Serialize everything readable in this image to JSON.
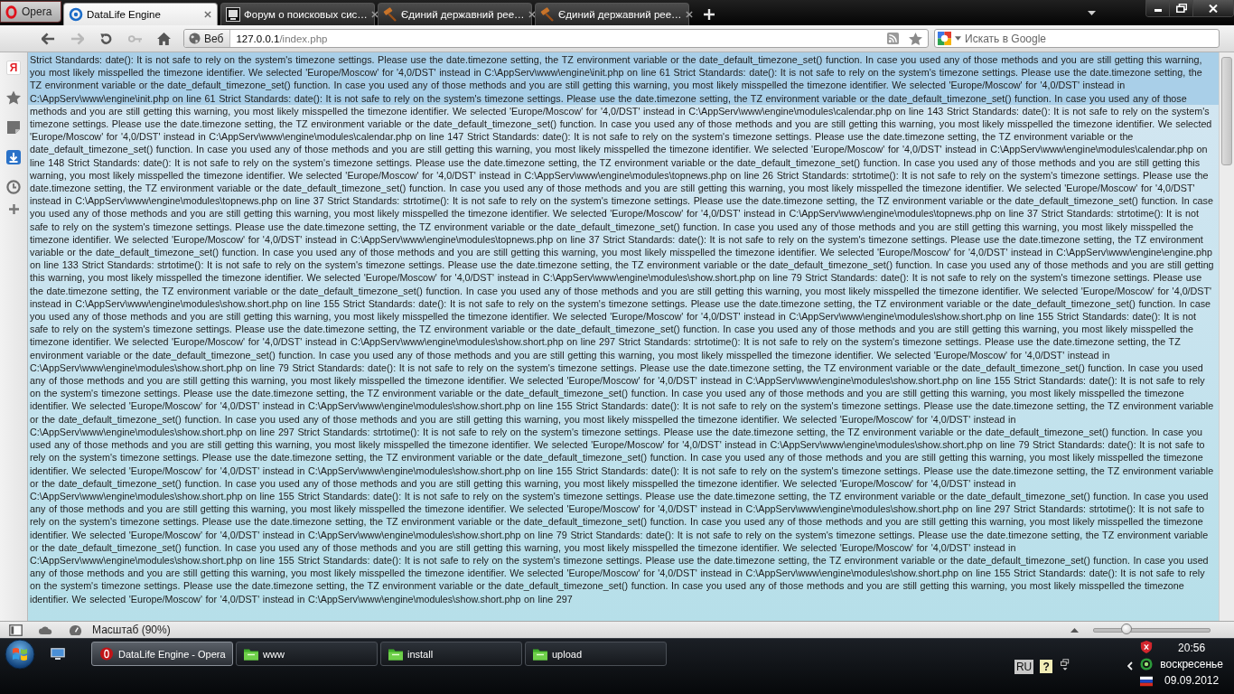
{
  "browser": {
    "menu_button": "Opera",
    "tabs": [
      {
        "title": "DataLife Engine",
        "kind": "portal",
        "selected": true
      },
      {
        "title": "Форум о поисковых сис…",
        "kind": "forum",
        "selected": false
      },
      {
        "title": "Єдиний державний рее…",
        "kind": "registry",
        "selected": false
      },
      {
        "title": "Єдиний державний рее…",
        "kind": "registry",
        "selected": false
      }
    ],
    "nav_buttons": [
      {
        "kind": "back",
        "disabled": false
      },
      {
        "kind": "forward",
        "disabled": true
      },
      {
        "kind": "reload",
        "disabled": false
      },
      {
        "kind": "wand",
        "disabled": true
      },
      {
        "kind": "home",
        "disabled": false
      }
    ],
    "address_bar": {
      "badge": "Веб",
      "host": "127.0.0.1",
      "path": "/index.php"
    },
    "search": {
      "placeholder": "Искать в Google"
    },
    "side_panel": {
      "letter_button": "Я"
    },
    "page": {
      "messages": [
        "Strict Standards: date(): It is not safe to rely on the system's timezone settings. Please use the date.timezone setting, the TZ environment variable or the date_default_timezone_set() function. In case you used any of those methods and you are still getting this warning, you most likely misspelled the timezone identifier. We selected 'Europe/Moscow' for '4,0/DST' instead in C:\\AppServ\\www\\engine\\init.php on line 61",
        "Strict Standards: date(): It is not safe to rely on the system's timezone settings. Please use the date.timezone setting, the TZ environment variable or the date_default_timezone_set() function. In case you used any of those methods and you are still getting this warning, you most likely misspelled the timezone identifier. We selected 'Europe/Moscow' for '4,0/DST' instead in C:\\AppServ\\www\\engine\\init.php on line 61",
        "Strict Standards: date(): It is not safe to rely on the system's timezone settings. Please use the date.timezone setting, the TZ environment variable or the date_default_timezone_set() function. In case you used any of those methods and you are still getting this warning, you most likely misspelled the timezone identifier. We selected 'Europe/Moscow' for '4,0/DST' instead in C:\\AppServ\\www\\engine\\modules\\calendar.php on line 143",
        "Strict Standards: date(): It is not safe to rely on the system's timezone settings. Please use the date.timezone setting, the TZ environment variable or the date_default_timezone_set() function. In case you used any of those methods and you are still getting this warning, you most likely misspelled the timezone identifier. We selected 'Europe/Moscow' for '4,0/DST' instead in C:\\AppServ\\www\\engine\\modules\\calendar.php on line 147",
        "Strict Standards: date(): It is not safe to rely on the system's timezone settings. Please use the date.timezone setting, the TZ environment variable or the date_default_timezone_set() function. In case you used any of those methods and you are still getting this warning, you most likely misspelled the timezone identifier. We selected 'Europe/Moscow' for '4,0/DST' instead in C:\\AppServ\\www\\engine\\modules\\calendar.php on line 148",
        "Strict Standards: date(): It is not safe to rely on the system's timezone settings. Please use the date.timezone setting, the TZ environment variable or the date_default_timezone_set() function. In case you used any of those methods and you are still getting this warning, you most likely misspelled the timezone identifier. We selected 'Europe/Moscow' for '4,0/DST' instead in C:\\AppServ\\www\\engine\\modules\\topnews.php on line 26",
        "Strict Standards: strtotime(): It is not safe to rely on the system's timezone settings. Please use the date.timezone setting, the TZ environment variable or the date_default_timezone_set() function. In case you used any of those methods and you are still getting this warning, you most likely misspelled the timezone identifier. We selected 'Europe/Moscow' for '4,0/DST' instead in C:\\AppServ\\www\\engine\\modules\\topnews.php on line 37",
        "Strict Standards: strtotime(): It is not safe to rely on the system's timezone settings. Please use the date.timezone setting, the TZ environment variable or the date_default_timezone_set() function. In case you used any of those methods and you are still getting this warning, you most likely misspelled the timezone identifier. We selected 'Europe/Moscow' for '4,0/DST' instead in C:\\AppServ\\www\\engine\\modules\\topnews.php on line 37",
        "Strict Standards: strtotime(): It is not safe to rely on the system's timezone settings. Please use the date.timezone setting, the TZ environment variable or the date_default_timezone_set() function. In case you used any of those methods and you are still getting this warning, you most likely misspelled the timezone identifier. We selected 'Europe/Moscow' for '4,0/DST' instead in C:\\AppServ\\www\\engine\\modules\\topnews.php on line 37",
        "Strict Standards: date(): It is not safe to rely on the system's timezone settings. Please use the date.timezone setting, the TZ environment variable or the date_default_timezone_set() function. In case you used any of those methods and you are still getting this warning, you most likely misspelled the timezone identifier. We selected 'Europe/Moscow' for '4,0/DST' instead in C:\\AppServ\\www\\engine\\engine.php on line 133",
        "Strict Standards: strtotime(): It is not safe to rely on the system's timezone settings. Please use the date.timezone setting, the TZ environment variable or the date_default_timezone_set() function. In case you used any of those methods and you are still getting this warning, you most likely misspelled the timezone identifier. We selected 'Europe/Moscow' for '4,0/DST' instead in C:\\AppServ\\www\\engine\\modules\\show.short.php on line 79",
        "Strict Standards: date(): It is not safe to rely on the system's timezone settings. Please use the date.timezone setting, the TZ environment variable or the date_default_timezone_set() function. In case you used any of those methods and you are still getting this warning, you most likely misspelled the timezone identifier. We selected 'Europe/Moscow' for '4,0/DST' instead in C:\\AppServ\\www\\engine\\modules\\show.short.php on line 155",
        "Strict Standards: date(): It is not safe to rely on the system's timezone settings. Please use the date.timezone setting, the TZ environment variable or the date_default_timezone_set() function. In case you used any of those methods and you are still getting this warning, you most likely misspelled the timezone identifier. We selected 'Europe/Moscow' for '4,0/DST' instead in C:\\AppServ\\www\\engine\\modules\\show.short.php on line 155",
        "Strict Standards: date(): It is not safe to rely on the system's timezone settings. Please use the date.timezone setting, the TZ environment variable or the date_default_timezone_set() function. In case you used any of those methods and you are still getting this warning, you most likely misspelled the timezone identifier. We selected 'Europe/Moscow' for '4,0/DST' instead in C:\\AppServ\\www\\engine\\modules\\show.short.php on line 297",
        "Strict Standards: strtotime(): It is not safe to rely on the system's timezone settings. Please use the date.timezone setting, the TZ environment variable or the date_default_timezone_set() function. In case you used any of those methods and you are still getting this warning, you most likely misspelled the timezone identifier. We selected 'Europe/Moscow' for '4,0/DST' instead in C:\\AppServ\\www\\engine\\modules\\show.short.php on line 79",
        "Strict Standards: date(): It is not safe to rely on the system's timezone settings. Please use the date.timezone setting, the TZ environment variable or the date_default_timezone_set() function. In case you used any of those methods and you are still getting this warning, you most likely misspelled the timezone identifier. We selected 'Europe/Moscow' for '4,0/DST' instead in C:\\AppServ\\www\\engine\\modules\\show.short.php on line 155",
        "Strict Standards: date(): It is not safe to rely on the system's timezone settings. Please use the date.timezone setting, the TZ environment variable or the date_default_timezone_set() function. In case you used any of those methods and you are still getting this warning, you most likely misspelled the timezone identifier. We selected 'Europe/Moscow' for '4,0/DST' instead in C:\\AppServ\\www\\engine\\modules\\show.short.php on line 155",
        "Strict Standards: date(): It is not safe to rely on the system's timezone settings. Please use the date.timezone setting, the TZ environment variable or the date_default_timezone_set() function. In case you used any of those methods and you are still getting this warning, you most likely misspelled the timezone identifier. We selected 'Europe/Moscow' for '4,0/DST' instead in C:\\AppServ\\www\\engine\\modules\\show.short.php on line 297",
        "Strict Standards: strtotime(): It is not safe to rely on the system's timezone settings. Please use the date.timezone setting, the TZ environment variable or the date_default_timezone_set() function. In case you used any of those methods and you are still getting this warning, you most likely misspelled the timezone identifier. We selected 'Europe/Moscow' for '4,0/DST' instead in C:\\AppServ\\www\\engine\\modules\\show.short.php on line 79",
        "Strict Standards: date(): It is not safe to rely on the system's timezone settings. Please use the date.timezone setting, the TZ environment variable or the date_default_timezone_set() function. In case you used any of those methods and you are still getting this warning, you most likely misspelled the timezone identifier. We selected 'Europe/Moscow' for '4,0/DST' instead in C:\\AppServ\\www\\engine\\modules\\show.short.php on line 155",
        "Strict Standards: date(): It is not safe to rely on the system's timezone settings. Please use the date.timezone setting, the TZ environment variable or the date_default_timezone_set() function. In case you used any of those methods and you are still getting this warning, you most likely misspelled the timezone identifier. We selected 'Europe/Moscow' for '4,0/DST' instead in C:\\AppServ\\www\\engine\\modules\\show.short.php on line 155",
        "Strict Standards: date(): It is not safe to rely on the system's timezone settings. Please use the date.timezone setting, the TZ environment variable or the date_default_timezone_set() function. In case you used any of those methods and you are still getting this warning, you most likely misspelled the timezone identifier. We selected 'Europe/Moscow' for '4,0/DST' instead in C:\\AppServ\\www\\engine\\modules\\show.short.php on line 297",
        "Strict Standards: strtotime(): It is not safe to rely on the system's timezone settings. Please use the date.timezone setting, the TZ environment variable or the date_default_timezone_set() function. In case you used any of those methods and you are still getting this warning, you most likely misspelled the timezone identifier. We selected 'Europe/Moscow' for '4,0/DST' instead in C:\\AppServ\\www\\engine\\modules\\show.short.php on line 79",
        "Strict Standards: date(): It is not safe to rely on the system's timezone settings. Please use the date.timezone setting, the TZ environment variable or the date_default_timezone_set() function. In case you used any of those methods and you are still getting this warning, you most likely misspelled the timezone identifier. We selected 'Europe/Moscow' for '4,0/DST' instead in C:\\AppServ\\www\\engine\\modules\\show.short.php on line 155",
        "Strict Standards: date(): It is not safe to rely on the system's timezone settings. Please use the date.timezone setting, the TZ environment variable or the date_default_timezone_set() function. In case you used any of those methods and you are still getting this warning, you most likely misspelled the timezone identifier. We selected 'Europe/Moscow' for '4,0/DST' instead in C:\\AppServ\\www\\engine\\modules\\show.short.php on line 155",
        "Strict Standards: date(): It is not safe to rely on the system's timezone settings. Please use the date.timezone setting, the TZ environment variable or the date_default_timezone_set() function. In case you used any of those methods and you are still getting this warning, you most likely misspelled the timezone identifier. We selected 'Europe/Moscow' for '4,0/DST' instead in C:\\AppServ\\www\\engine\\modules\\show.short.php on line 297"
      ]
    },
    "status_bar": {
      "zoom_label": "Масштаб (90%)",
      "zoom_slider": {
        "level": 0.28
      }
    }
  },
  "taskbar": {
    "buttons": [
      {
        "label": "DataLife Engine - Opera",
        "kind": "browser",
        "selected": true
      },
      {
        "label": "www",
        "kind": "folder",
        "selected": false
      },
      {
        "label": "install",
        "kind": "folder",
        "selected": false
      },
      {
        "label": "upload",
        "kind": "folder",
        "selected": false
      }
    ],
    "tray": {
      "language": "RU",
      "help": "?",
      "time": "20:56",
      "day": "воскресенье",
      "date": "09.09.2012"
    }
  }
}
